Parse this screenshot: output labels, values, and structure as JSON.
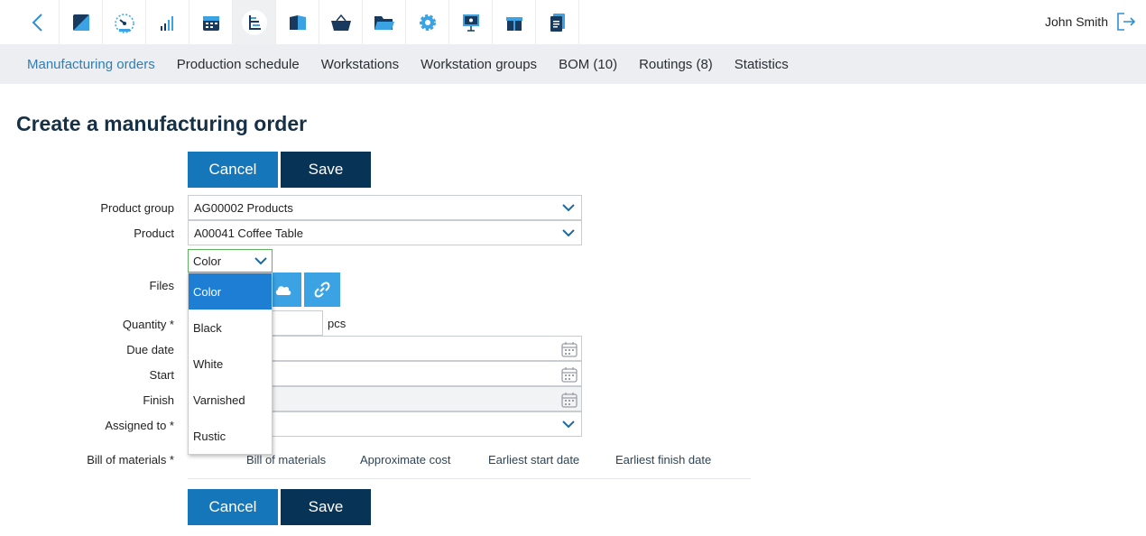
{
  "topbar": {
    "icons": [
      "back-chevron-icon",
      "dashboard-square-icon",
      "gauge-icon",
      "signal-bars-icon",
      "calendar-icon",
      "production-gantt-icon",
      "book-icon",
      "basket-icon",
      "folder-icon",
      "settings-gear-icon",
      "presentation-icon",
      "gift-icon",
      "document-icon"
    ],
    "user_name": "John Smith"
  },
  "subnav": {
    "items": [
      "Manufacturing orders",
      "Production schedule",
      "Workstations",
      "Workstation groups",
      "BOM (10)",
      "Routings (8)",
      "Statistics"
    ],
    "active_index": 0
  },
  "page": {
    "title": "Create a manufacturing order",
    "cancel_label": "Cancel",
    "save_label": "Save"
  },
  "form": {
    "product_group_label": "Product group",
    "product_group_value": "AG00002 Products",
    "product_label": "Product",
    "product_value": "A00041 Coffee Table",
    "color_select_value": "Color",
    "files_label": "Files",
    "quantity_label": "Quantity *",
    "quantity_unit": "pcs",
    "due_date_label": "Due date",
    "start_label": "Start",
    "finish_label": "Finish",
    "assigned_to_label": "Assigned to *",
    "bom_label": "Bill of materials *"
  },
  "color_dropdown": {
    "options": [
      "Color",
      "Black",
      "White",
      "Varnished",
      "Rustic"
    ],
    "selected_index": 0
  },
  "bom_table": {
    "columns": [
      "Bill of materials",
      "Approximate cost",
      "Earliest start date",
      "Earliest finish date"
    ]
  },
  "colors": {
    "primary": "#1577b9",
    "dark": "#073456",
    "accent_light": "#3ba3e4",
    "active_nav": "#2f7eb5"
  }
}
